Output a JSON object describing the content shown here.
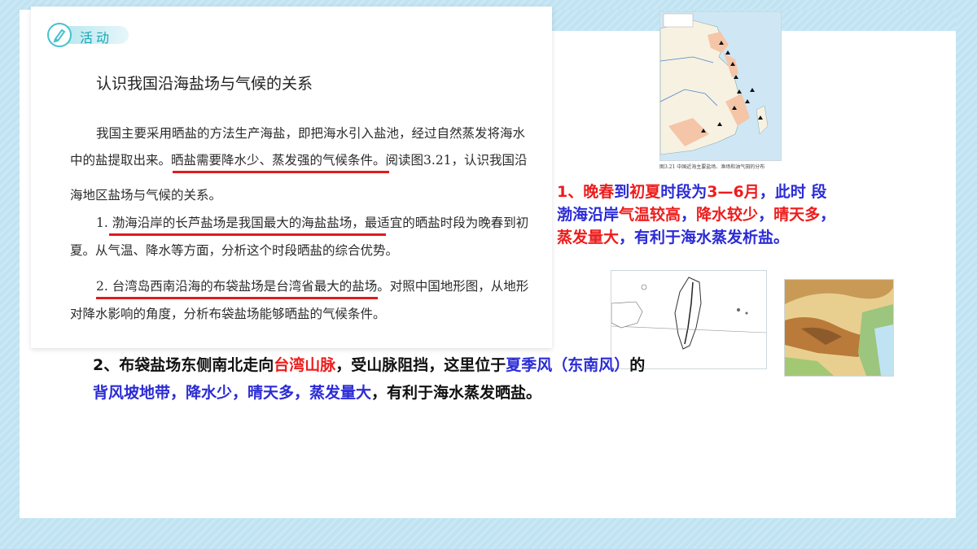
{
  "activity": {
    "badge": "活动",
    "title": "认识我国沿海盐场与气候的关系",
    "intro_l1": "我国主要采用晒盐的方法生产海盐，即把海水引入盐池，经过自然蒸发将海水",
    "intro_l2a": "中的盐提取出来。",
    "intro_l2b": "晒盐需要降水少、蒸发强的气候条件。",
    "intro_l2c": "阅读图3.21，认识我国沿",
    "intro_l3": "海地区盐场与气候的关系。",
    "q1_l1a": "1. ",
    "q1_l1b": "渤海沿岸的长芦盐场是我国最大的海盐盐场，",
    "q1_l1c": "最适宜的晒盐时段为晚春到初",
    "q1_l2": "夏。从气温、降水等方面，分析这个时段晒盐的综合优势。",
    "q2_l1a": "2. 台湾岛西南沿海的布袋盐场是台湾省最大的盐场。",
    "q2_l1b": "对照中国地形图，从地形",
    "q2_l2": "对降水影响的角度，分析布袋盐场能够晒盐的气候条件。"
  },
  "map_caption": "图3.21 中国近海主要盐场、渔场和油气田的分布",
  "answer1": {
    "p1": "1、晚春",
    "p2": "到",
    "p3": "初夏",
    "p4": "时段为",
    "p5": "3—6月",
    "p6": "，此时 段",
    "p7": "渤海沿岸",
    "p8": "气温较高",
    "p9": "，",
    "p10": "降水较少",
    "p11": "，",
    "p12": "晴天多",
    "p13": "，",
    "p14": "蒸发量大",
    "p15": "，有利于海水蒸发析盐。"
  },
  "answer2": {
    "p1": "2、布袋盐场东侧南北走向",
    "p2": "台湾山脉",
    "p3": "，受山脉阻挡，这里位于",
    "p4": "夏季风（东南风）",
    "p5": "的",
    "p6": "背风坡地带，降水少，晴天多，蒸发量大",
    "p7": "，有利于海水蒸发晒盐。"
  },
  "colors": {
    "background": "#bfe3f2",
    "red": "#ee1c1c",
    "blue": "#2b2bd6",
    "teal": "#1aa5b6"
  }
}
